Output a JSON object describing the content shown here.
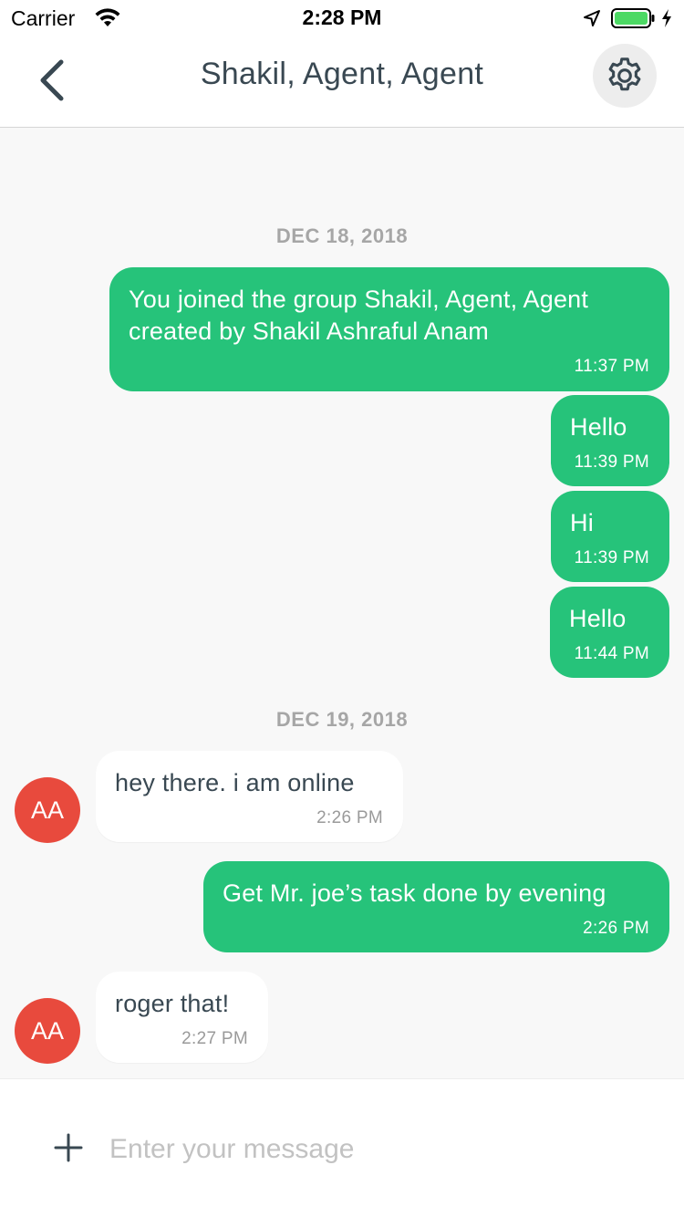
{
  "status_bar": {
    "carrier": "Carrier",
    "time": "2:28 PM"
  },
  "nav": {
    "title": "Shakil, Agent, Agent",
    "back_icon": "chevron-left-icon",
    "settings_icon": "gear-icon"
  },
  "dates": [
    "DEC 18, 2018",
    "DEC 19, 2018"
  ],
  "messages": [
    {
      "direction": "out",
      "text": "You joined the group Shakil, Agent, Agent\ncreated by Shakil Ashraful Anam",
      "time": "11:37 PM"
    },
    {
      "direction": "out",
      "text": "Hello",
      "time": "11:39 PM"
    },
    {
      "direction": "out",
      "text": "Hi",
      "time": "11:39 PM"
    },
    {
      "direction": "out",
      "text": "Hello",
      "time": "11:44 PM"
    },
    {
      "direction": "in",
      "avatar": "AA",
      "text": "hey there. i am online",
      "time": "2:26 PM"
    },
    {
      "direction": "out",
      "text": "Get Mr. joe’s task done by evening",
      "time": "2:26 PM"
    },
    {
      "direction": "in",
      "avatar": "AA",
      "text": "roger that!",
      "time": "2:27 PM"
    }
  ],
  "composer": {
    "placeholder": "Enter your message",
    "value": ""
  },
  "colors": {
    "outgoing_bubble": "#26c37a",
    "avatar": "#e84a3d",
    "title_text": "#394852"
  }
}
